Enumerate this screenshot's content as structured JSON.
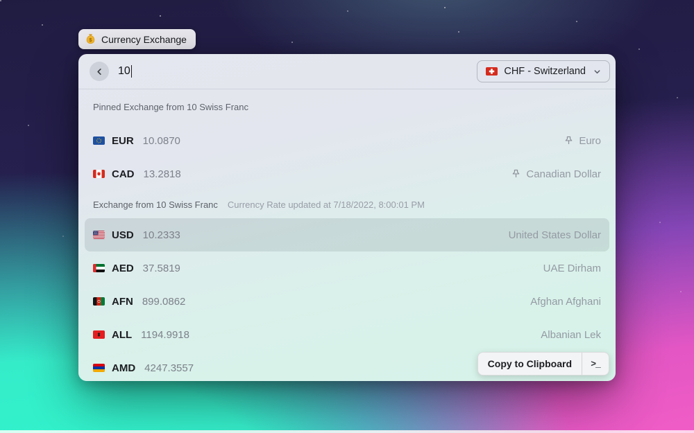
{
  "window": {
    "chip": {
      "label": "Currency Exchange",
      "icon": "money-bag-icon"
    }
  },
  "search": {
    "value": "10",
    "back_icon": "chevron-left-icon",
    "dropdown": {
      "flag": "ch",
      "label": "CHF - Switzerland",
      "chevron_icon": "chevron-down-icon"
    }
  },
  "sections": [
    {
      "title": "Pinned Exchange from 10 Swiss Franc",
      "meta": "",
      "items": [
        {
          "flag": "eu",
          "code": "EUR",
          "value": "10.0870",
          "pinned": true,
          "name": "Euro",
          "selected": false
        },
        {
          "flag": "ca",
          "code": "CAD",
          "value": "13.2818",
          "pinned": true,
          "name": "Canadian Dollar",
          "selected": false
        }
      ]
    },
    {
      "title": "Exchange from 10 Swiss Franc",
      "meta": "Currency Rate updated at 7/18/2022, 8:00:01 PM",
      "items": [
        {
          "flag": "us",
          "code": "USD",
          "value": "10.2333",
          "pinned": false,
          "name": "United States Dollar",
          "selected": true
        },
        {
          "flag": "ae",
          "code": "AED",
          "value": "37.5819",
          "pinned": false,
          "name": "UAE Dirham",
          "selected": false
        },
        {
          "flag": "af",
          "code": "AFN",
          "value": "899.0862",
          "pinned": false,
          "name": "Afghan Afghani",
          "selected": false
        },
        {
          "flag": "al",
          "code": "ALL",
          "value": "1194.9918",
          "pinned": false,
          "name": "Albanian Lek",
          "selected": false
        },
        {
          "flag": "am",
          "code": "AMD",
          "value": "4247.3557",
          "pinned": false,
          "name": "",
          "selected": false
        }
      ]
    }
  ],
  "action_bar": {
    "primary_label": "Copy to Clipboard",
    "terminal_glyph": ">_",
    "terminal_icon": "terminal-prompt-icon"
  },
  "icons": [
    "money-bag-icon",
    "chevron-left-icon",
    "chevron-down-icon",
    "pin-icon",
    "terminal-prompt-icon"
  ],
  "colors": {
    "accent_teal": "#35ecc9",
    "accent_pink": "#e356c4",
    "bg_dark": "#262050",
    "panel_top": "#e5e7ef",
    "panel_bottom": "#d6f3e9",
    "selected_row": "rgba(100,120,125,0.17)"
  }
}
